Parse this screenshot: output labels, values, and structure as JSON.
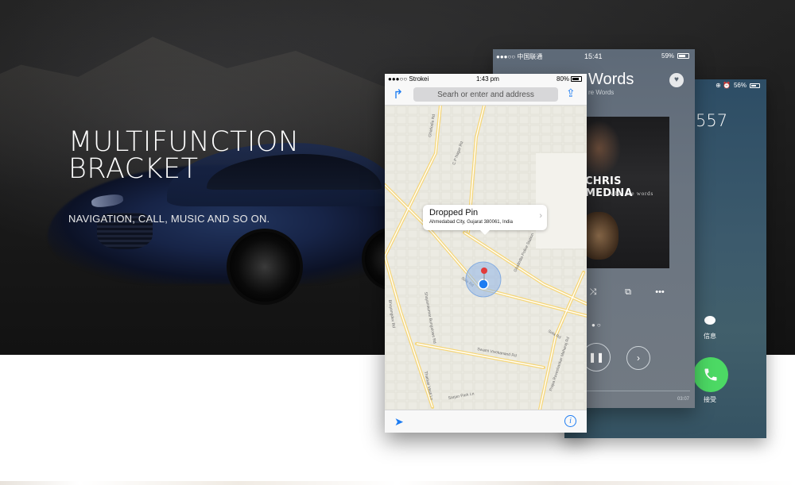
{
  "hero": {
    "title_line1": "MULTIFUNCTION",
    "title_line2": "BRACKET",
    "subtitle": "NAVIGATION, CALL, MUSIC AND SO ON."
  },
  "map_phone": {
    "carrier": "●●●○○ Strokei",
    "time": "1:43 pm",
    "battery": "80%",
    "search_placeholder": "Searh or enter and address",
    "pin_title": "Dropped Pin",
    "pin_address": "Ahmedabad City, Gujarat 380061, India",
    "roads": [
      "Ghatlodia Rd",
      "C P Nagar Rd",
      "Sola Rd",
      "Shayamkumar Bungalows Rd",
      "Bhuyangdev Rd",
      "Swami Vivekanand Rd",
      "Thakkar Vasti Ln",
      "Prapa Raveshankar Maharaj Rd",
      "Ghatlodia Police Station",
      "Sarjan Park Ln",
      "Sola Rd"
    ],
    "icons": {
      "directions": "directions-arrow-icon",
      "share": "share-icon",
      "locate": "location-arrow-icon",
      "info": "info-icon"
    }
  },
  "music_phone": {
    "carrier": "●●●○○ 中国联通",
    "time": "15:41",
    "battery": "59%",
    "song_title": "Words",
    "song_sub": "re Words",
    "artist": "CHRIS MEDINA",
    "album_sub": "what are words",
    "elapsed": "03:07",
    "icons": {
      "heart": "heart-icon",
      "shuffle": "shuffle-icon",
      "repeat": "repeat-icon",
      "more": "more-icon",
      "pause": "pause-icon",
      "next": "next-icon"
    }
  },
  "call_phone": {
    "battery": "56%",
    "number": "557",
    "message_label": "信息",
    "accept_label": "接受",
    "colors": {
      "accept": "#4cd964"
    }
  }
}
